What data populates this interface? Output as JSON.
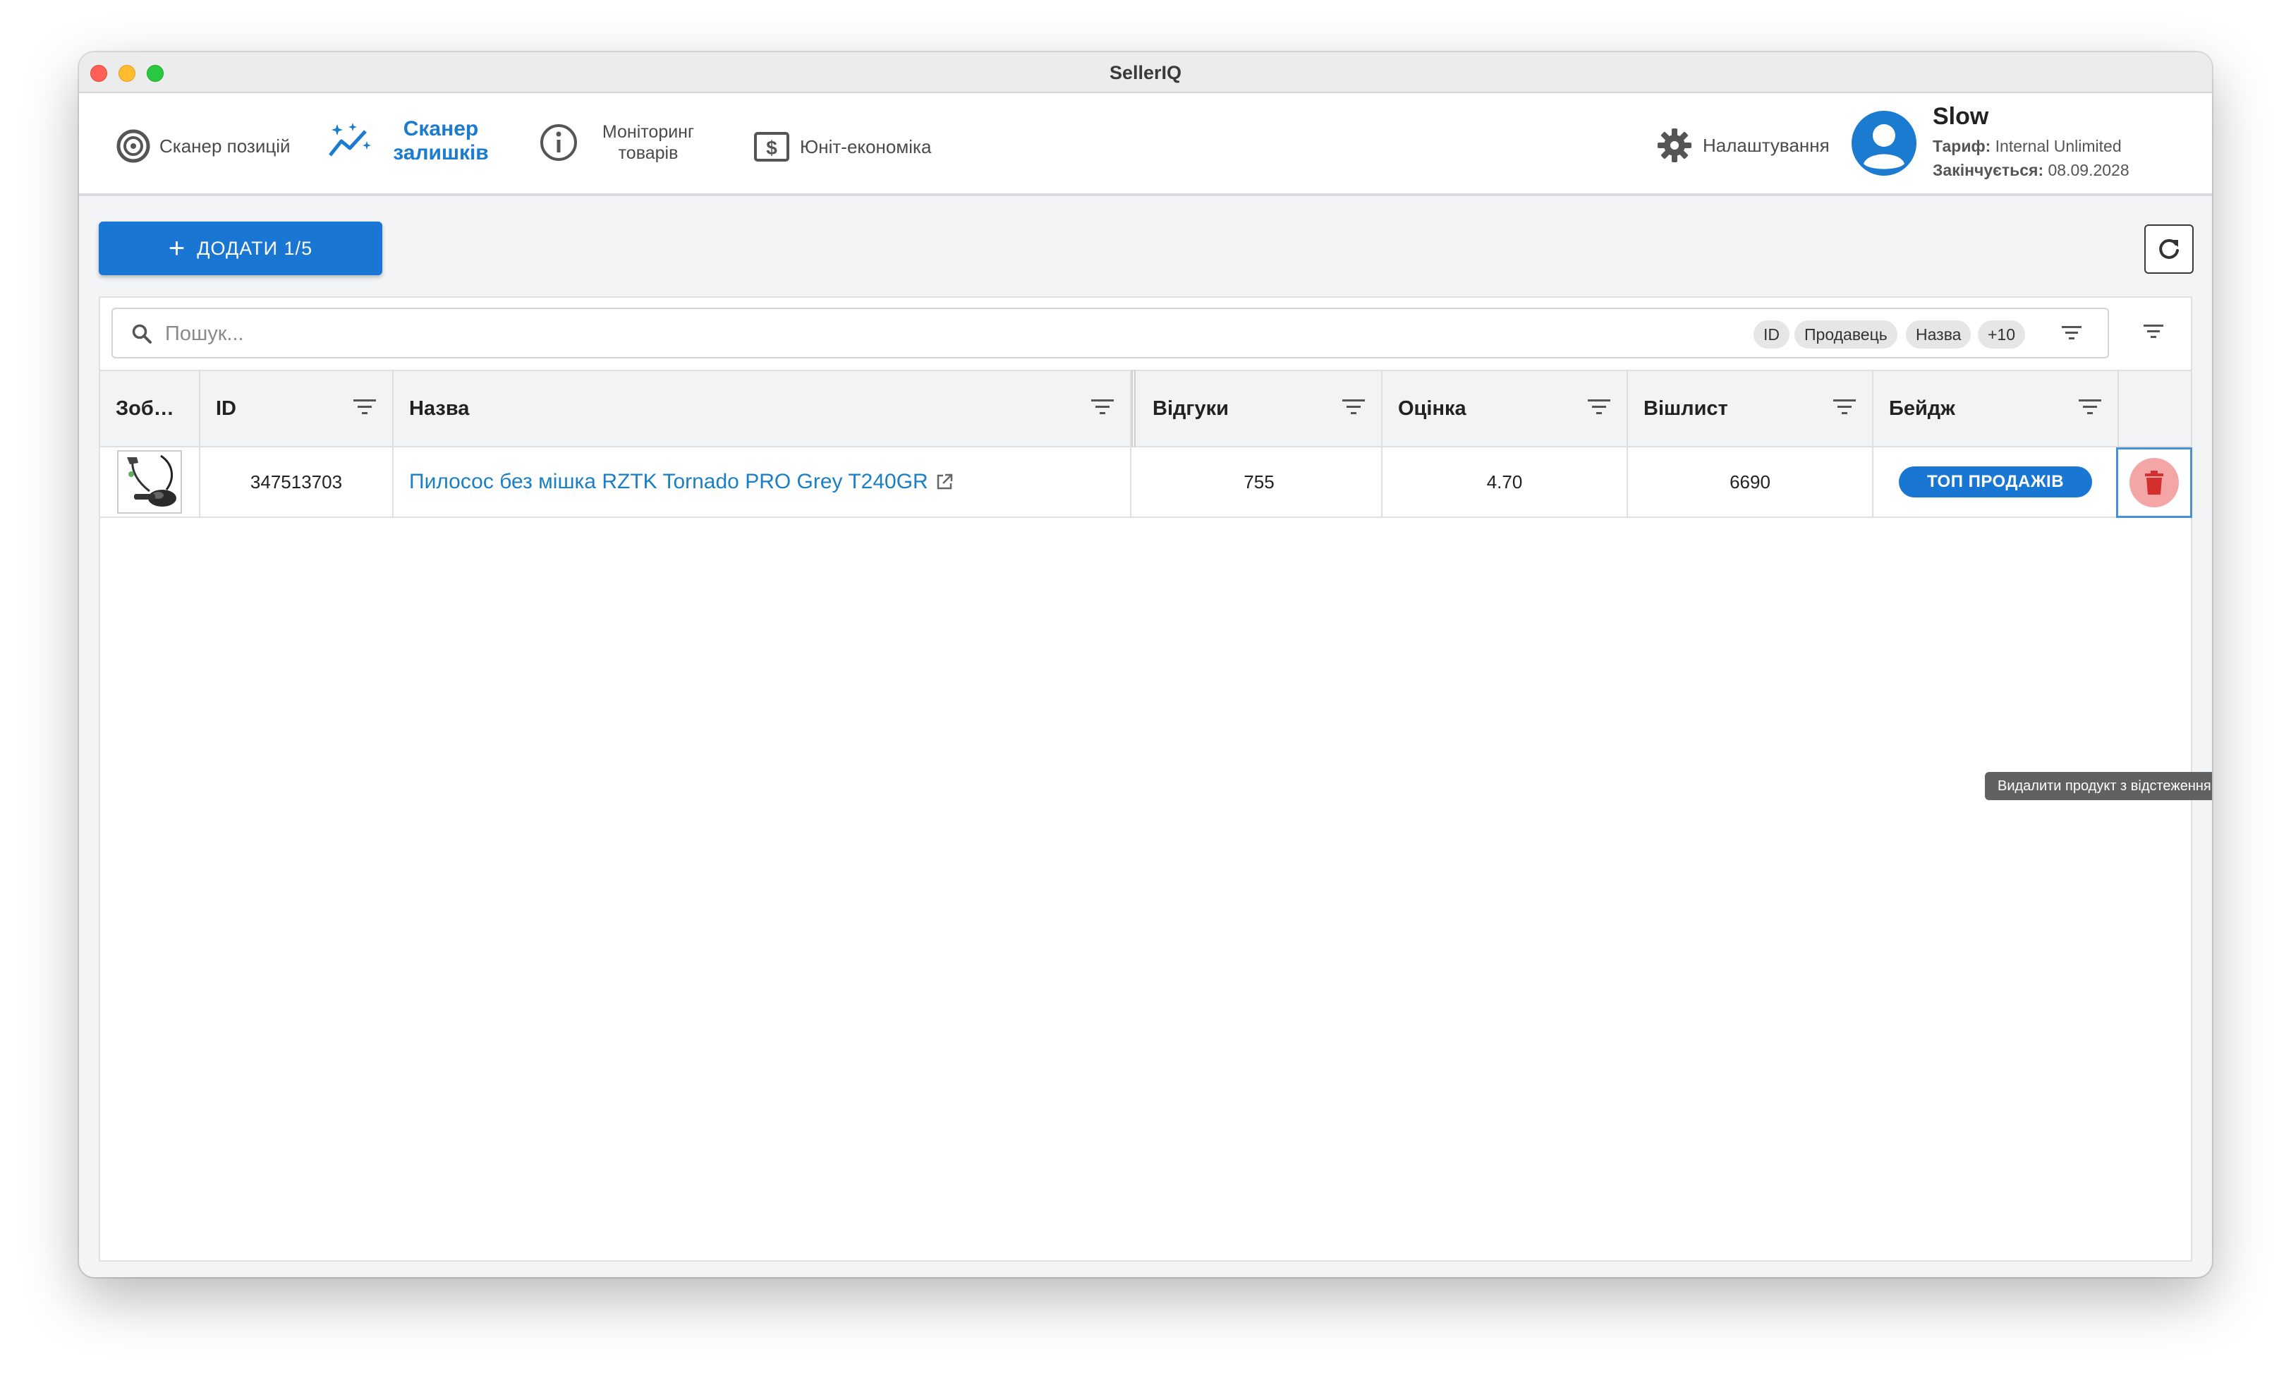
{
  "window": {
    "title": "SellerIQ"
  },
  "nav": {
    "position_scanner": "Сканер позицій",
    "stock_scanner": "Сканер залишків",
    "monitoring": "Моніторинг товарів",
    "unit_economics": "Юніт-економіка",
    "settings": "Налаштування"
  },
  "user": {
    "name": "Slow",
    "plan_label": "Тариф:",
    "plan_value": "Internal Unlimited",
    "expires_label": "Закінчується:",
    "expires_value": "08.09.2028"
  },
  "toolbar": {
    "add_label": "ДОДАТИ 1/5"
  },
  "search": {
    "placeholder": "Пошук...",
    "chips": [
      "ID",
      "Продавець",
      "Назва",
      "+10"
    ]
  },
  "table": {
    "columns": [
      "Зоб…",
      "ID",
      "Назва",
      "Відгуки",
      "Оцінка",
      "Вішлист",
      "Бейдж"
    ],
    "rows": [
      {
        "id": "347513703",
        "name": "Пилосос без мішка RZTK Tornado PRO Grey T240GR",
        "reviews": "755",
        "rating": "4.70",
        "wishlist": "6690",
        "badge": "ТОП ПРОДАЖІВ"
      }
    ]
  },
  "tooltip": {
    "delete": "Видалити продукт з відстеження"
  },
  "colors": {
    "accent": "#1976d2",
    "link": "#1a7fc4",
    "delete_bg": "#f4a6a6",
    "delete_icon": "#d32f2f"
  }
}
